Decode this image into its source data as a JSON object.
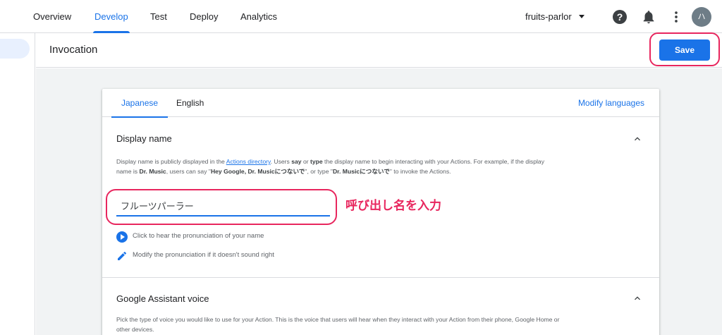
{
  "nav": {
    "tabs": [
      {
        "label": "Overview"
      },
      {
        "label": "Develop"
      },
      {
        "label": "Test"
      },
      {
        "label": "Deploy"
      },
      {
        "label": "Analytics"
      }
    ],
    "active_tab": "Develop",
    "project": "fruits-parlor",
    "avatar_text": "ハ",
    "help_glyph": "?"
  },
  "header": {
    "title": "Invocation",
    "save_label": "Save"
  },
  "card": {
    "lang_tabs": [
      {
        "label": "Japanese"
      },
      {
        "label": "English"
      }
    ],
    "active_lang": "Japanese",
    "modify_languages": "Modify languages",
    "display_name": {
      "title": "Display name",
      "desc_1": "Display name is publicly displayed in the ",
      "desc_link": "Actions directory",
      "desc_2": ". Users ",
      "desc_say": "say",
      "desc_3": " or ",
      "desc_type": "type",
      "desc_4": " the display name to begin interacting with your Actions. For example, if the display name is ",
      "desc_drmusic": "Dr. Music",
      "desc_5": ", users can say \"",
      "desc_hey": "Hey Google, Dr. Musicにつないで",
      "desc_6": "\", or type \"",
      "desc_dr2": "Dr. Musicにつないで",
      "desc_7": "\" to invoke the Actions.",
      "input_value": "フルーツパーラー",
      "annotation": "呼び出し名を入力",
      "hear_label": "Click to hear the pronunciation of your name",
      "modify_label": "Modify the pronunciation if it doesn't sound right"
    },
    "voice": {
      "title": "Google Assistant voice",
      "desc": "Pick the type of voice you would like to use for your Action. This is the voice that users will hear when they interact with your Action from their phone, Google Home or other devices."
    }
  },
  "colors": {
    "accent": "#1a73e8",
    "highlight": "#e8265e"
  }
}
